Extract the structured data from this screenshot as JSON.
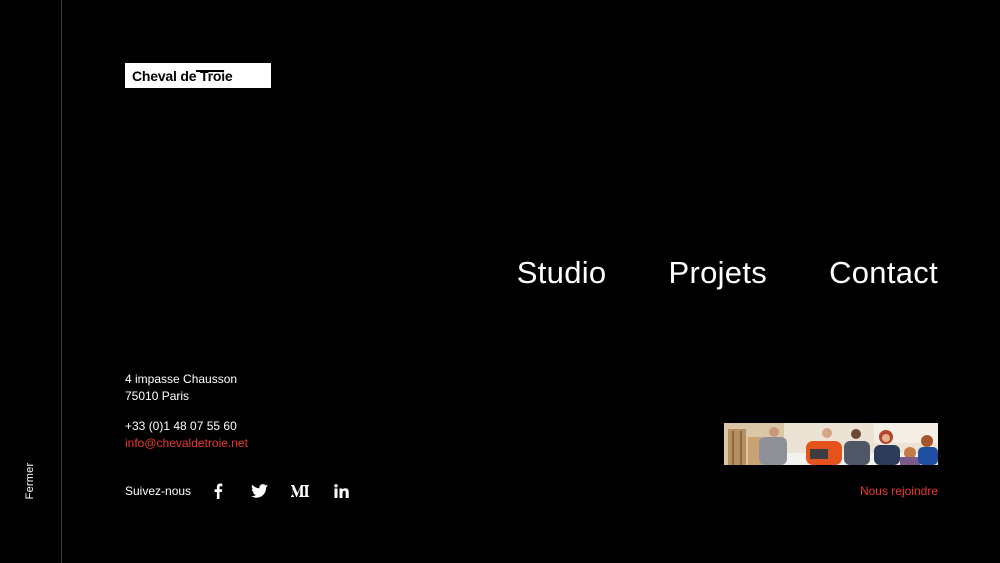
{
  "rail": {
    "close_label": "Fermer"
  },
  "logo": {
    "text": "Cheval de Troie"
  },
  "nav": {
    "items": [
      {
        "label": "Studio"
      },
      {
        "label": "Projets"
      },
      {
        "label": "Contact"
      }
    ]
  },
  "contact": {
    "address_line1": "4 impasse Chausson",
    "address_line2": "75010 Paris",
    "phone": "+33 (0)1 48 07 55 60",
    "email": "info@chevaldetroie.net"
  },
  "social": {
    "label": "Suivez-nous",
    "icons": [
      "facebook-icon",
      "twitter-icon",
      "medium-icon",
      "linkedin-icon"
    ]
  },
  "join": {
    "label": "Nous rejoindre",
    "photo": "team-photo"
  },
  "colors": {
    "background": "#000000",
    "text": "#ffffff",
    "accent": "#e83a2f",
    "rail_border": "#3a3a3a"
  }
}
